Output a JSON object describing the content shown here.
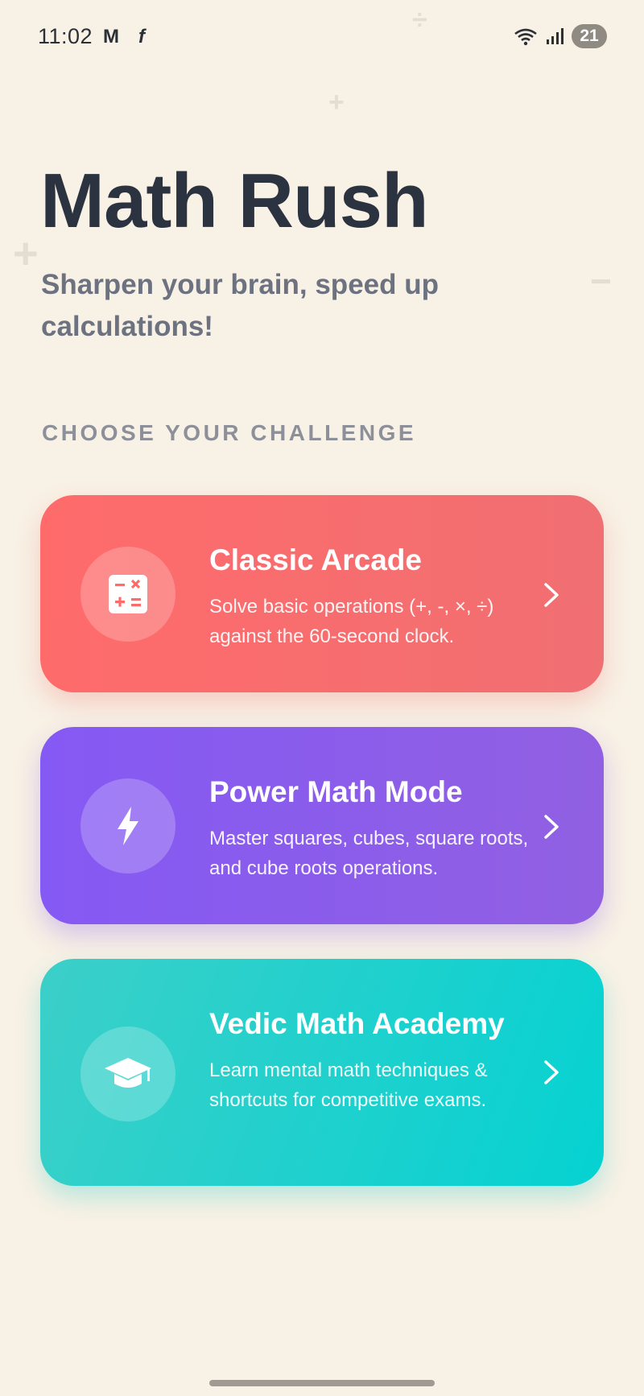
{
  "status_bar": {
    "time": "11:02",
    "app_icons": [
      "M",
      "f"
    ],
    "battery": "21"
  },
  "decorations": [
    "÷",
    "+",
    "+",
    "−"
  ],
  "header": {
    "title": "Math Rush",
    "subtitle": "Sharpen your brain, speed up calculations!"
  },
  "section_heading": "CHOOSE YOUR CHALLENGE",
  "modes": [
    {
      "title": "Classic Arcade",
      "description": "Solve basic operations (+, -, ×, ÷) against the 60-second clock.",
      "icon": "calculator-icon",
      "color": "#ff6b6b"
    },
    {
      "title": "Power Math Mode",
      "description": "Master squares, cubes, square roots, and cube roots operations.",
      "icon": "lightning-icon",
      "color": "#8559f4"
    },
    {
      "title": "Vedic Math Academy",
      "description": "Learn mental math techniques & shortcuts for competitive exams.",
      "icon": "graduation-cap-icon",
      "color": "#17d1cd"
    }
  ],
  "colors": {
    "background": "#f8f1e5",
    "title": "#2b3240",
    "subtitle": "#6d7280",
    "section_heading": "#8d9099"
  }
}
